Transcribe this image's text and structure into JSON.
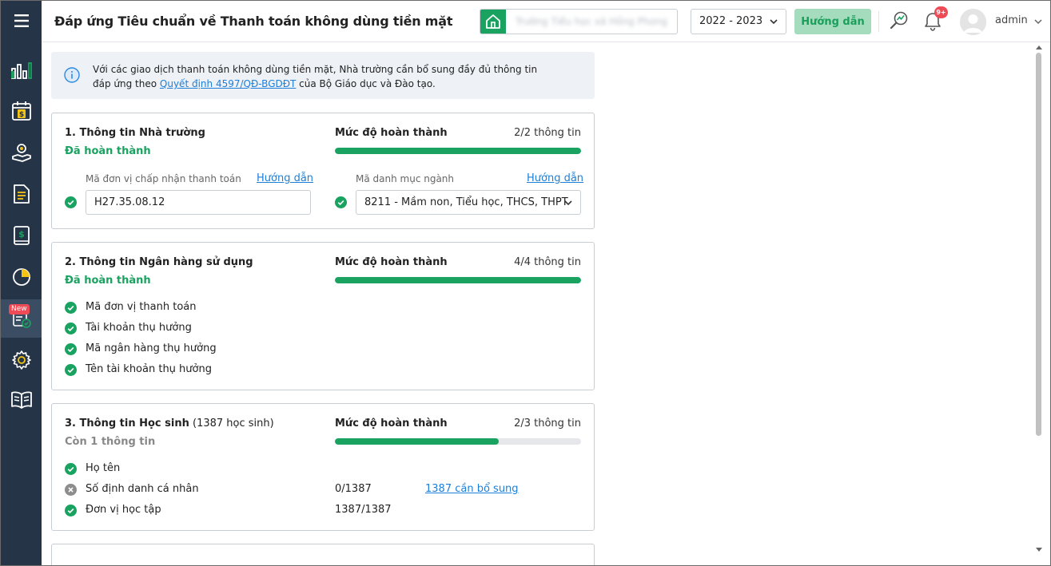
{
  "header": {
    "title": "Đáp ứng Tiêu chuẩn về Thanh toán không dùng tiền mặt",
    "school_name": "Trường Tiểu học xã Hồng Phong",
    "year": "2022 - 2023",
    "guide_label": "Hướng dẫn",
    "notification_badge": "9+",
    "user_name": "admin"
  },
  "sidebar": {
    "new_badge": "New",
    "items": [
      "menu-icon",
      "chart-icon",
      "fee-calendar-icon",
      "payment-hand-icon",
      "document-icon",
      "money-book-icon",
      "pie-chart-icon",
      "checklist-icon",
      "gear-icon",
      "open-book-icon"
    ]
  },
  "info": {
    "text_before": "Với các giao dịch thanh toán không dùng tiền mặt, Nhà trường cần bổ sung đầy đủ thông tin đáp ứng theo ",
    "link": "Quyết định 4597/QĐ-BGDĐT",
    "text_after": " của Bộ Giáo dục và Đào tạo."
  },
  "sections": [
    {
      "title": "1. Thông tin Nhà trường",
      "status": "Đã hoàn thành",
      "progress_label": "Mức độ hoàn thành",
      "progress_count": "2/2 thông tin",
      "progress": 1.0,
      "fields": [
        {
          "label": "Mã đơn vị chấp nhận thanh toán",
          "link": "Hướng dẫn",
          "value": "H27.35.08.12"
        },
        {
          "label": "Mã danh mục ngành",
          "link": "Hướng dẫn",
          "value": "8211 - Mầm non, Tiểu học, THCS, THPT"
        }
      ]
    },
    {
      "title": "2. Thông tin Ngân hàng sử dụng",
      "status": "Đã hoàn thành",
      "progress_label": "Mức độ hoàn thành",
      "progress_count": "4/4 thông tin",
      "progress": 1.0,
      "items": [
        "Mã đơn vị thanh toán",
        "Tài khoản thụ hưởng",
        "Mã ngân hàng thụ hưởng",
        "Tên tài khoản thụ hưởng"
      ]
    },
    {
      "title": "3. Thông tin Học sinh",
      "title_sub": " (1387 học sinh)",
      "status": "Còn 1 thông tin",
      "progress_label": "Mức độ hoàn thành",
      "progress_count": "2/3 thông tin",
      "progress": 0.667,
      "items": [
        {
          "label": "Họ tên",
          "value": "",
          "link": "",
          "done": true
        },
        {
          "label": "Số định danh cá nhân",
          "value": "0/1387",
          "link": "1387 cần bổ sung",
          "done": false
        },
        {
          "label": "Đơn vị học tập",
          "value": "1387/1387",
          "link": "",
          "done": true
        }
      ]
    }
  ],
  "colors": {
    "sidebar": "#253446",
    "accent_green": "#1aa260",
    "link_blue": "#1d7fd8",
    "badge_red": "#ef4b56"
  }
}
